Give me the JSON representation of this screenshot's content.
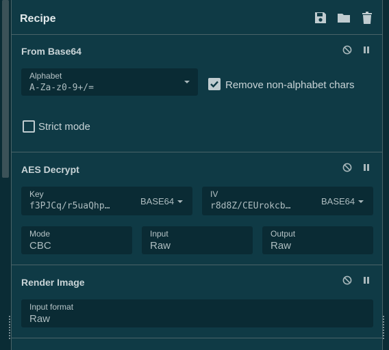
{
  "recipe": {
    "title": "Recipe",
    "actions": [
      "save-icon",
      "folder-icon",
      "trash-icon"
    ]
  },
  "operations": [
    {
      "name": "From Base64",
      "alphabet": {
        "label": "Alphabet",
        "value": "A-Za-z0-9+/="
      },
      "remove_non_alphabet": {
        "label": "Remove non-alphabet chars",
        "checked": true
      },
      "strict_mode": {
        "label": "Strict mode",
        "checked": false
      }
    },
    {
      "name": "AES Decrypt",
      "key": {
        "label": "Key",
        "value": "f3PJCq/r5uaQhp…",
        "encoding": "BASE64"
      },
      "iv": {
        "label": "IV",
        "value": "r8d8Z/CEUrokcb…",
        "encoding": "BASE64"
      },
      "mode": {
        "label": "Mode",
        "value": "CBC"
      },
      "input": {
        "label": "Input",
        "value": "Raw"
      },
      "output": {
        "label": "Output",
        "value": "Raw"
      }
    },
    {
      "name": "Render Image",
      "input_format": {
        "label": "Input format",
        "value": "Raw"
      }
    }
  ],
  "colors": {
    "panel": "#0f3a45",
    "field": "#0a2b34",
    "border": "#4a6469",
    "text": "#c9d4d7"
  }
}
